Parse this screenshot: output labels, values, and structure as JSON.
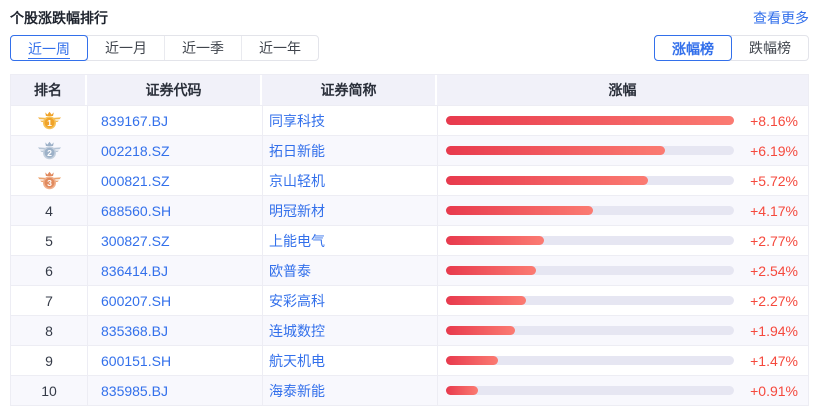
{
  "header": {
    "title": "个股涨跌幅排行",
    "more_link": "查看更多"
  },
  "period_tabs": [
    {
      "label": "近一周",
      "selected": true
    },
    {
      "label": "近一月",
      "selected": false
    },
    {
      "label": "近一季",
      "selected": false
    },
    {
      "label": "近一年",
      "selected": false
    }
  ],
  "board_tabs": [
    {
      "label": "涨幅榜",
      "selected": true
    },
    {
      "label": "跌幅榜",
      "selected": false
    }
  ],
  "table": {
    "headers": [
      "排名",
      "证券代码",
      "证券简称",
      "涨幅"
    ],
    "max_pct": 8.16,
    "rows": [
      {
        "rank": 1,
        "medal": "gold",
        "code": "839167.BJ",
        "name": "同享科技",
        "change": "+8.16%",
        "pct": 8.16
      },
      {
        "rank": 2,
        "medal": "silver",
        "code": "002218.SZ",
        "name": "拓日新能",
        "change": "+6.19%",
        "pct": 6.19
      },
      {
        "rank": 3,
        "medal": "bronze",
        "code": "000821.SZ",
        "name": "京山轻机",
        "change": "+5.72%",
        "pct": 5.72
      },
      {
        "rank": 4,
        "medal": null,
        "code": "688560.SH",
        "name": "明冠新材",
        "change": "+4.17%",
        "pct": 4.17
      },
      {
        "rank": 5,
        "medal": null,
        "code": "300827.SZ",
        "name": "上能电气",
        "change": "+2.77%",
        "pct": 2.77
      },
      {
        "rank": 6,
        "medal": null,
        "code": "836414.BJ",
        "name": "欧普泰",
        "change": "+2.54%",
        "pct": 2.54
      },
      {
        "rank": 7,
        "medal": null,
        "code": "600207.SH",
        "name": "安彩高科",
        "change": "+2.27%",
        "pct": 2.27
      },
      {
        "rank": 8,
        "medal": null,
        "code": "835368.BJ",
        "name": "连城数控",
        "change": "+1.94%",
        "pct": 1.94
      },
      {
        "rank": 9,
        "medal": null,
        "code": "600151.SH",
        "name": "航天机电",
        "change": "+1.47%",
        "pct": 1.47
      },
      {
        "rank": 10,
        "medal": null,
        "code": "835985.BJ",
        "name": "海泰新能",
        "change": "+0.91%",
        "pct": 0.91
      }
    ]
  },
  "colors": {
    "blue": "#3370eb",
    "red": "#f5493d",
    "bar_from": "#e83a4d",
    "bar_to": "#fb7b72",
    "track": "#e6e6f2",
    "header_bg": "#f1f1f9",
    "alt_row_bg": "#f8f8fd",
    "border": "#ededf4",
    "medal_gold": "#f0a32a",
    "medal_silver": "#9db1c8",
    "medal_bronze": "#e08a5e"
  }
}
